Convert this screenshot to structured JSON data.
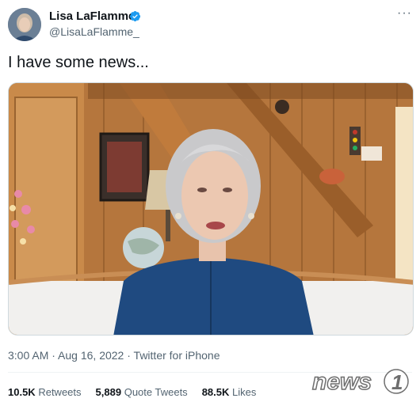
{
  "author": {
    "display_name": "Lisa LaFlamme",
    "handle": "@LisaLaFlamme_",
    "verified": true
  },
  "more_label": "···",
  "tweet": {
    "text": "I have some news...",
    "time": "3:00 AM",
    "date": "Aug 16, 2022",
    "source": "Twitter for iPhone",
    "separator": " · "
  },
  "stats": {
    "retweets_count": "10.5K",
    "retweets_label": "Retweets",
    "quote_count": "5,889",
    "quote_label": "Quote Tweets",
    "likes_count": "88.5K",
    "likes_label": "Likes"
  },
  "watermark": {
    "text": "news",
    "number": "1"
  },
  "colors": {
    "verified": "#1d9bf0",
    "secondary_text": "#536471",
    "primary_text": "#0f1419"
  }
}
